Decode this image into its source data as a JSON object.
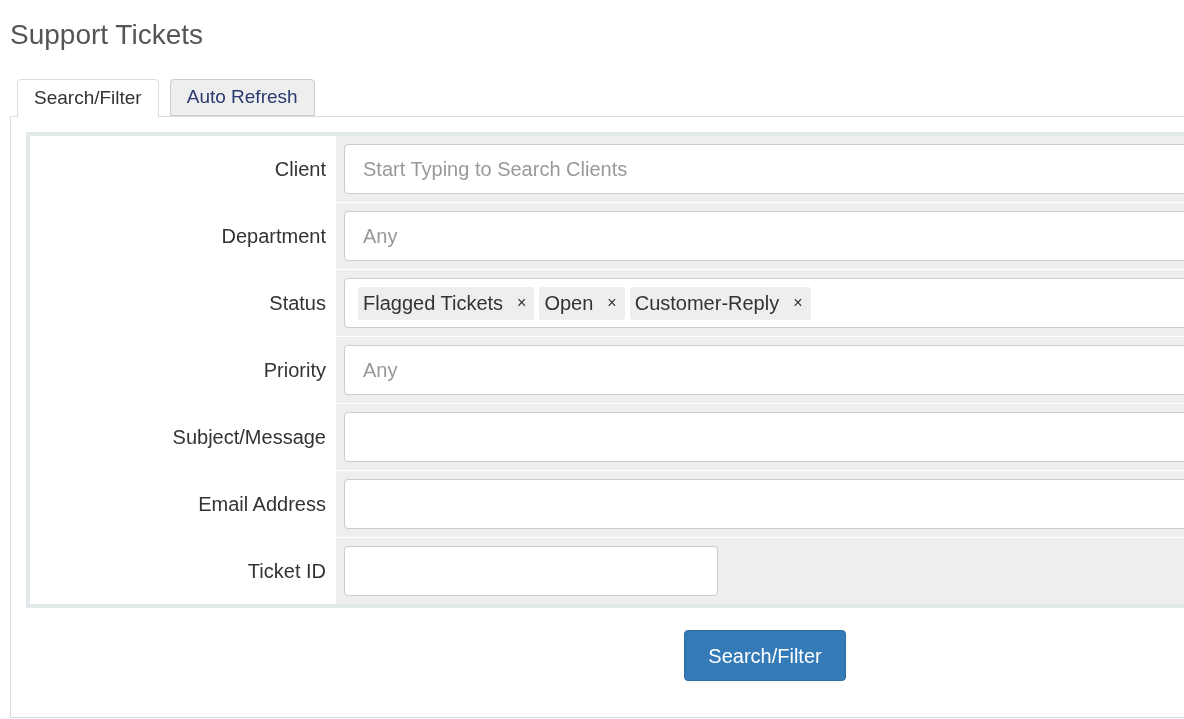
{
  "page_title": "Support Tickets",
  "tabs": [
    {
      "label": "Search/Filter",
      "selected": true
    },
    {
      "label": "Auto Refresh",
      "selected": false
    }
  ],
  "fields": [
    {
      "label": "Client",
      "kind": "text",
      "placeholder": "Start Typing to Search Clients"
    },
    {
      "label": "Department",
      "kind": "text",
      "placeholder": "Any"
    },
    {
      "label": "Status",
      "kind": "tags",
      "tags": [
        "Flagged Tickets",
        "Open",
        "Customer-Reply"
      ],
      "remove_symbol": "×"
    },
    {
      "label": "Priority",
      "kind": "text",
      "placeholder": "Any"
    },
    {
      "label": "Subject/Message",
      "kind": "text"
    },
    {
      "label": "Email Address",
      "kind": "text"
    },
    {
      "label": "Ticket ID",
      "kind": "short_text"
    }
  ],
  "submit_button": "Search/Filter"
}
